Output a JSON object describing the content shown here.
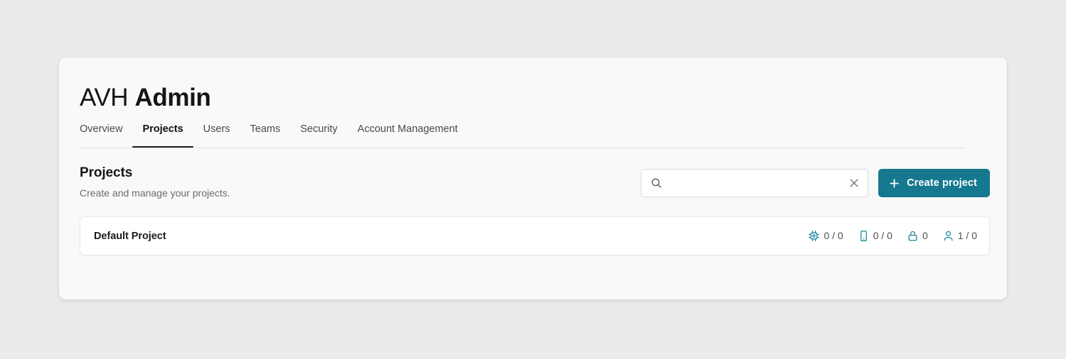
{
  "app": {
    "title_light": "AVH ",
    "title_bold": "Admin"
  },
  "tabs": [
    {
      "label": "Overview",
      "active": false
    },
    {
      "label": "Projects",
      "active": true
    },
    {
      "label": "Users",
      "active": false
    },
    {
      "label": "Teams",
      "active": false
    },
    {
      "label": "Security",
      "active": false
    },
    {
      "label": "Account Management",
      "active": false
    }
  ],
  "section": {
    "title": "Projects",
    "subtitle": "Create and manage your projects."
  },
  "search": {
    "value": "",
    "placeholder": "",
    "icon": "search-icon",
    "clear_icon": "close-icon"
  },
  "create_button": {
    "label": "Create project",
    "icon": "plus-icon",
    "color": "#15788e"
  },
  "projects": [
    {
      "name": "Default Project",
      "stats": [
        {
          "icon": "cpu-icon",
          "value": "0 / 0"
        },
        {
          "icon": "device-icon",
          "value": "0 / 0"
        },
        {
          "icon": "lock-icon",
          "value": "0"
        },
        {
          "icon": "user-icon",
          "value": "1 / 0"
        }
      ]
    }
  ],
  "colors": {
    "page_background": "#ebebeb",
    "panel_background": "#f9f9f9",
    "accent": "#15788e",
    "stat_icon": "#1b84a0",
    "text_primary": "#161616",
    "text_muted": "#6b6b6b"
  }
}
